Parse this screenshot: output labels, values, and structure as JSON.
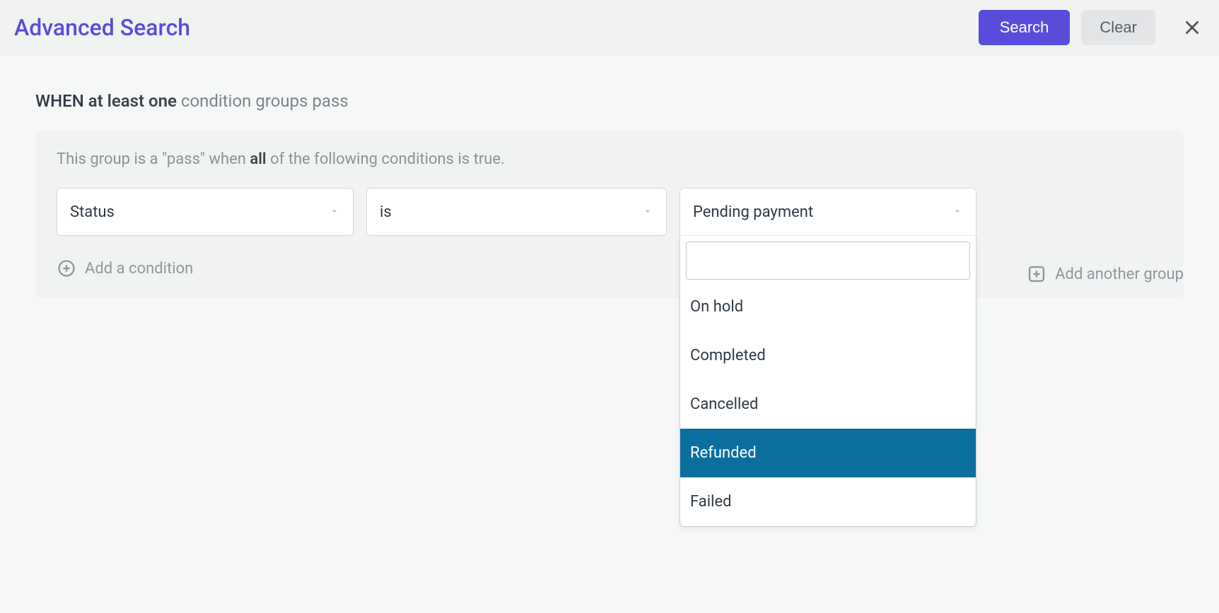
{
  "header": {
    "title": "Advanced Search",
    "search_label": "Search",
    "clear_label": "Clear"
  },
  "when": {
    "prefix": "WHEN",
    "mode": "at least one",
    "suffix": "condition groups pass"
  },
  "group": {
    "desc_prefix": "This group is a \"pass\" when",
    "mode": "all",
    "desc_suffix": "of the following conditions is true."
  },
  "condition": {
    "field": "Status",
    "operator": "is",
    "value": "Pending payment",
    "dropdown": {
      "search_value": "",
      "options": [
        {
          "label": "On hold",
          "highlight": false
        },
        {
          "label": "Completed",
          "highlight": false
        },
        {
          "label": "Cancelled",
          "highlight": false
        },
        {
          "label": "Refunded",
          "highlight": true
        },
        {
          "label": "Failed",
          "highlight": false
        }
      ]
    }
  },
  "actions": {
    "add_condition": "Add a condition",
    "add_group": "Add another group"
  },
  "colors": {
    "accent": "#5a4cdb",
    "highlight_bg": "#0a6f9e"
  }
}
